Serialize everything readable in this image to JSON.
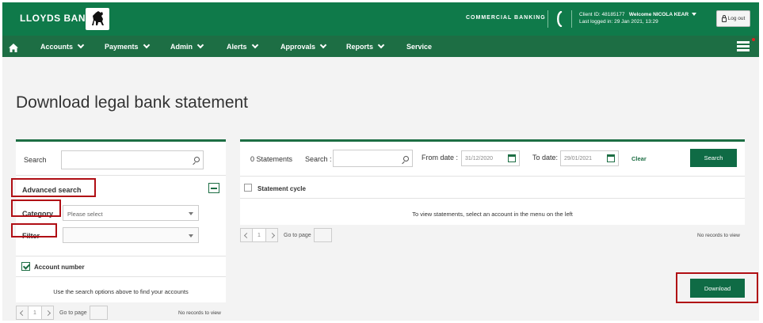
{
  "header": {
    "brand": "LLOYDS BANK",
    "section": "COMMERCIAL BANKING",
    "client_id": "Client ID: 48185177",
    "welcome": "Welcome NICOLA KEAR",
    "last_logged": "Last logged in: 29 Jan 2021, 13:29",
    "logout_label": "Log out"
  },
  "nav": {
    "items": [
      {
        "label": "Accounts",
        "has_caret": true
      },
      {
        "label": "Payments",
        "has_caret": true
      },
      {
        "label": "Admin",
        "has_caret": true
      },
      {
        "label": "Alerts",
        "has_caret": true
      },
      {
        "label": "Approvals",
        "has_caret": true
      },
      {
        "label": "Reports",
        "has_caret": true
      },
      {
        "label": "Service",
        "has_caret": false
      }
    ]
  },
  "page": {
    "title": "Download legal bank statement"
  },
  "left_panel": {
    "search_label": "Search",
    "search_value": "",
    "advanced_search_label": "Advanced search",
    "category_label": "Category",
    "category_placeholder": "Please select",
    "filter_label": "Filter",
    "filter_value": "",
    "account_number_label": "Account number",
    "message": "Use the search options above to find your accounts",
    "pager": {
      "page": "1",
      "goto_label": "Go to page",
      "no_records": "No records to view"
    }
  },
  "right_panel": {
    "count_label": "0 Statements",
    "search_label": "Search :",
    "search_value": "",
    "from_label": "From date :",
    "from_value": "31/12/2020",
    "to_label": "To date:",
    "to_value": "29/01/2021",
    "clear_label": "Clear",
    "search_button": "Search",
    "column_statement_cycle": "Statement cycle",
    "message": "To view statements, select an account in the menu on the left",
    "pager": {
      "page": "1",
      "goto_label": "Go to page",
      "no_records": "No records to view"
    }
  },
  "download_button": "Download",
  "colors": {
    "primary_green": "#0f7a4a",
    "nav_green": "#1d6e44",
    "annotation_red": "#b00e14"
  }
}
